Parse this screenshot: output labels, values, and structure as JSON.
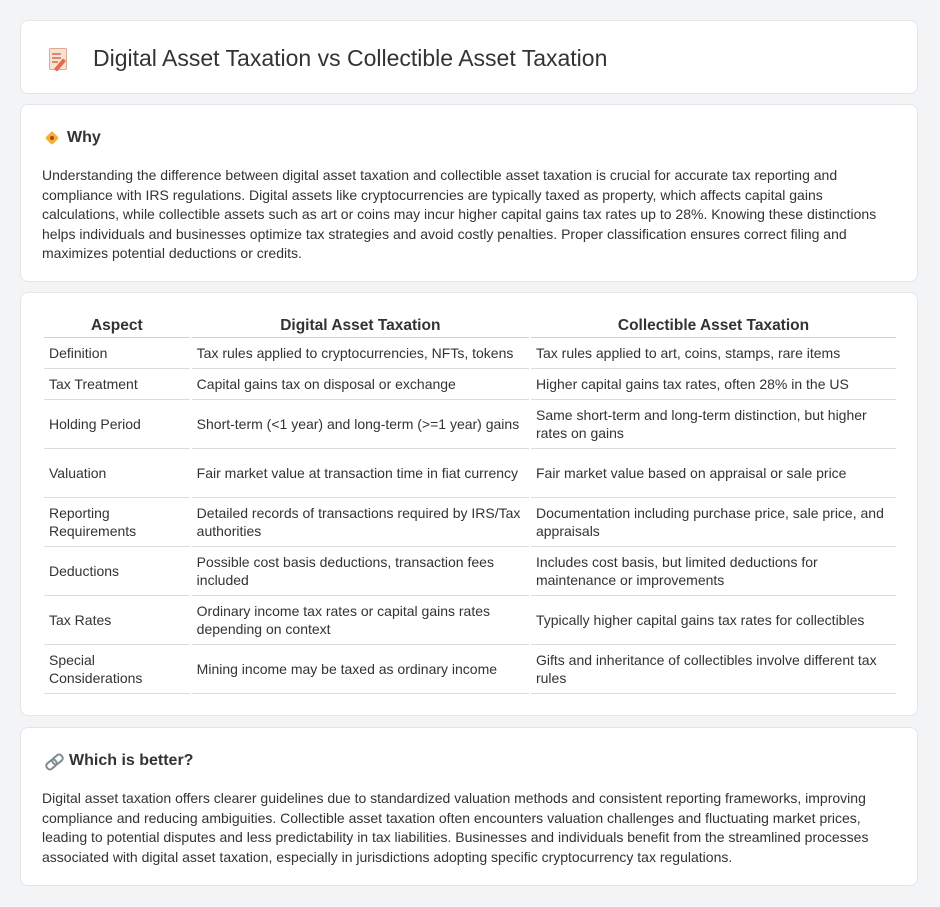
{
  "header": {
    "title": "Digital Asset Taxation vs Collectible Asset Taxation",
    "icon": "document-pencil-icon"
  },
  "why": {
    "heading": "Why",
    "icon": "diamond-bulb-icon",
    "text": "Understanding the difference between digital asset taxation and collectible asset taxation is crucial for accurate tax reporting and compliance with IRS regulations. Digital assets like cryptocurrencies are typically taxed as property, which affects capital gains calculations, while collectible assets such as art or coins may incur higher capital gains tax rates up to 28%. Knowing these distinctions helps individuals and businesses optimize tax strategies and avoid costly penalties. Proper classification ensures correct filing and maximizes potential deductions or credits."
  },
  "table": {
    "headers": [
      "Aspect",
      "Digital Asset Taxation",
      "Collectible Asset Taxation"
    ],
    "rows": [
      [
        "Definition",
        "Tax rules applied to cryptocurrencies, NFTs, tokens",
        "Tax rules applied to art, coins, stamps, rare items"
      ],
      [
        "Tax Treatment",
        "Capital gains tax on disposal or exchange",
        "Higher capital gains tax rates, often 28% in the US"
      ],
      [
        "Holding Period",
        "Short-term (<1 year) and long-term (>=1 year) gains",
        "Same short-term and long-term distinction, but higher rates on gains"
      ],
      [
        "Valuation",
        "Fair market value at transaction time in fiat currency",
        "Fair market value based on appraisal or sale price"
      ],
      [
        "Reporting Requirements",
        "Detailed records of transactions required by IRS/Tax authorities",
        "Documentation including purchase price, sale price, and appraisals"
      ],
      [
        "Deductions",
        "Possible cost basis deductions, transaction fees included",
        "Includes cost basis, but limited deductions for maintenance or improvements"
      ],
      [
        "Tax Rates",
        "Ordinary income tax rates or capital gains rates depending on context",
        "Typically higher capital gains tax rates for collectibles"
      ],
      [
        "Special Considerations",
        "Mining income may be taxed as ordinary income",
        "Gifts and inheritance of collectibles involve different tax rules"
      ]
    ]
  },
  "better": {
    "heading": "Which is better?",
    "icon": "link-icon",
    "text": "Digital asset taxation offers clearer guidelines due to standardized valuation methods and consistent reporting frameworks, improving compliance and reducing ambiguities. Collectible asset taxation often encounters valuation challenges and fluctuating market prices, leading to potential disputes and less predictability in tax liabilities. Businesses and individuals benefit from the streamlined processes associated with digital asset taxation, especially in jurisdictions adopting specific cryptocurrency tax regulations."
  }
}
